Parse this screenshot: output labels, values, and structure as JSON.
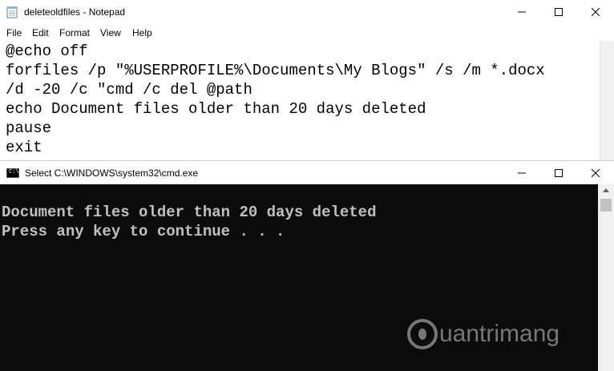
{
  "notepad": {
    "title": "deleteoldfiles - Notepad",
    "menu": [
      "File",
      "Edit",
      "Format",
      "View",
      "Help"
    ],
    "lines": [
      "@echo off",
      "forfiles /p \"%USERPROFILE%\\Documents\\My Blogs\" /s /m *.docx",
      "/d -20 /c \"cmd /c del @path",
      "echo Document files older than 20 days deleted",
      "pause",
      "exit"
    ]
  },
  "cmd": {
    "title": "Select C:\\WINDOWS\\system32\\cmd.exe",
    "icon_label": "C:\\",
    "output": [
      "Document files older than 20 days deleted",
      "Press any key to continue . . ."
    ]
  },
  "watermark": {
    "text": "uantrimang",
    "icon": "light-bulb-q-icon"
  },
  "colors": {
    "console_bg": "#0c0c0c",
    "console_text": "#c0c0c0"
  }
}
